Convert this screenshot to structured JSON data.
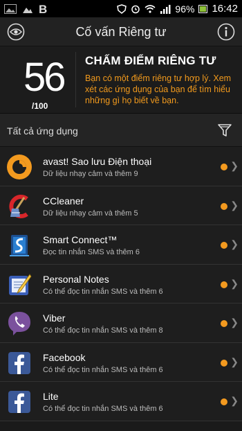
{
  "statusbar": {
    "battery": "96%",
    "time": "16:42"
  },
  "header": {
    "title": "Cố vấn Riêng tư"
  },
  "score": {
    "value": "56",
    "denominator": "/100",
    "title": "CHẤM ĐIỂM RIÊNG TƯ",
    "description": "Bạn có một điểm riêng tư hợp lý. Xem xét các ứng dụng của bạn để tìm hiểu những gì họ biết về bạn."
  },
  "filter": {
    "label": "Tất cả ứng dụng"
  },
  "apps": [
    {
      "name": "avast! Sao lưu Điện thoại",
      "desc": "Dữ liệu nhạy cảm và thêm 9",
      "icon": "avast-backup-icon"
    },
    {
      "name": "CCleaner",
      "desc": "Dữ liệu nhạy cảm và thêm 5",
      "icon": "ccleaner-icon"
    },
    {
      "name": "Smart Connect™",
      "desc": "Đọc tin nhắn SMS và thêm 6",
      "icon": "smart-connect-icon"
    },
    {
      "name": "Personal Notes",
      "desc": "Có thể đọc tin nhắn SMS và thêm 6",
      "icon": "notes-icon"
    },
    {
      "name": "Viber",
      "desc": "Có thể đọc tin nhắn SMS và thêm 8",
      "icon": "viber-icon"
    },
    {
      "name": "Facebook",
      "desc": "Có thể đọc tin nhắn SMS và thêm 6",
      "icon": "facebook-icon"
    },
    {
      "name": "Lite",
      "desc": "Có thể đọc tin nhắn SMS và thêm 6",
      "icon": "facebook-lite-icon"
    }
  ],
  "colors": {
    "accent": "#f29a1c",
    "background": "#1e1e1e"
  }
}
